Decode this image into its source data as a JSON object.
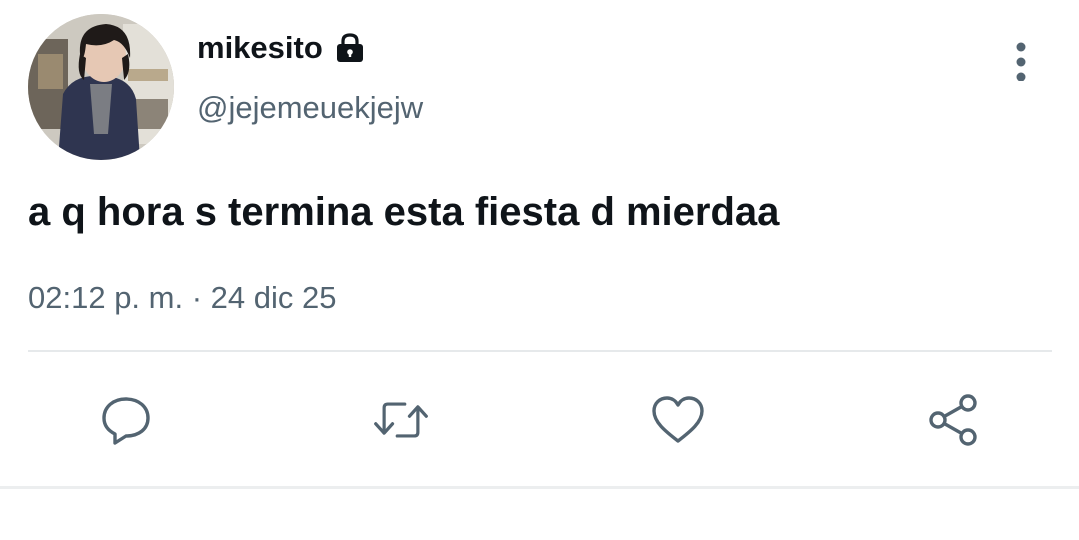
{
  "user": {
    "display_name": "mikesito",
    "handle": "@jejemeuekjejw",
    "protected_icon": "lock-icon"
  },
  "tweet": {
    "text": "a q hora s termina esta fiesta d mierdaa",
    "timestamp": "02:12 p. m. · 24 dic 25"
  },
  "actions": {
    "reply_icon": "comment-bubble-icon",
    "retweet_icon": "retweet-icon",
    "like_icon": "heart-icon",
    "share_icon": "share-icon"
  },
  "menu": {
    "more_icon": "vertical-dots-icon"
  },
  "colors": {
    "text_primary": "#0f1419",
    "text_secondary": "#536471",
    "divider": "#e6e9eb"
  }
}
